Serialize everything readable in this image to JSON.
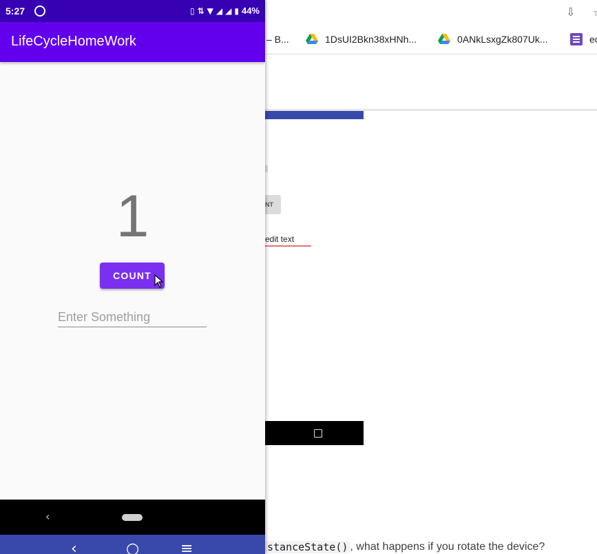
{
  "browser": {
    "bookmarks": [
      {
        "label": "– B..."
      },
      {
        "label": "1DsUI2Bkn38xHNh..."
      },
      {
        "label": "0ANkLsxgZk807Uk..."
      },
      {
        "label": "ec"
      }
    ],
    "faded": {
      "count_button": "NT",
      "edit_text": "edit text"
    },
    "bottom_code": "stanceState()",
    "bottom_text": ", what happens if you rotate the device?"
  },
  "status_bar": {
    "time": "5:27",
    "battery": "44%"
  },
  "app": {
    "title": "LifeCycleHomeWork",
    "counter_value": "1",
    "count_button_label": "COUNT",
    "input_placeholder": "Enter Something",
    "input_value": ""
  },
  "colors": {
    "status_bar": "#3700b3",
    "app_bar": "#6200ee",
    "button": "#7b2ff0",
    "host_taskbar": "#3949ab"
  }
}
